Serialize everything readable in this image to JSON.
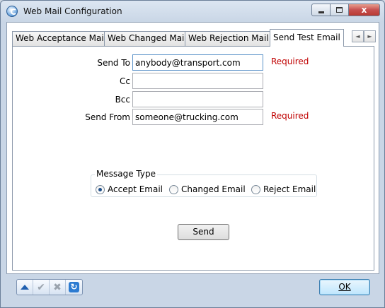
{
  "window": {
    "title": "Web Mail Configuration",
    "close_glyph": "x"
  },
  "tabs": [
    {
      "label": "Web Acceptance Mail",
      "active": false
    },
    {
      "label": "Web Changed Mail",
      "active": false
    },
    {
      "label": "Web Rejection Mail",
      "active": false
    },
    {
      "label": "Send Test Email",
      "active": true
    }
  ],
  "tab_scroll": {
    "left": "◄",
    "right": "►"
  },
  "form": {
    "send_to": {
      "label": "Send To",
      "value": "anybody@transport.com",
      "required_text": "Required"
    },
    "cc": {
      "label": "Cc",
      "value": ""
    },
    "bcc": {
      "label": "Bcc",
      "value": ""
    },
    "send_from": {
      "label": "Send From",
      "value": "someone@trucking.com",
      "required_text": "Required"
    }
  },
  "message_type": {
    "legend": "Message Type",
    "options": [
      {
        "label": "Accept Email",
        "checked": true
      },
      {
        "label": "Changed Email",
        "checked": false
      },
      {
        "label": "Reject Email",
        "checked": false
      }
    ]
  },
  "send_button": "Send",
  "toolbar": {
    "icons": [
      "up-arrow-icon",
      "check-icon",
      "x-icon",
      "refresh-icon"
    ],
    "check_glyph": "✔",
    "x_glyph": "✖",
    "refresh_glyph": "↻"
  },
  "ok_button": "OK",
  "colors": {
    "required": "#c00000",
    "accent": "#2c7bd1"
  }
}
